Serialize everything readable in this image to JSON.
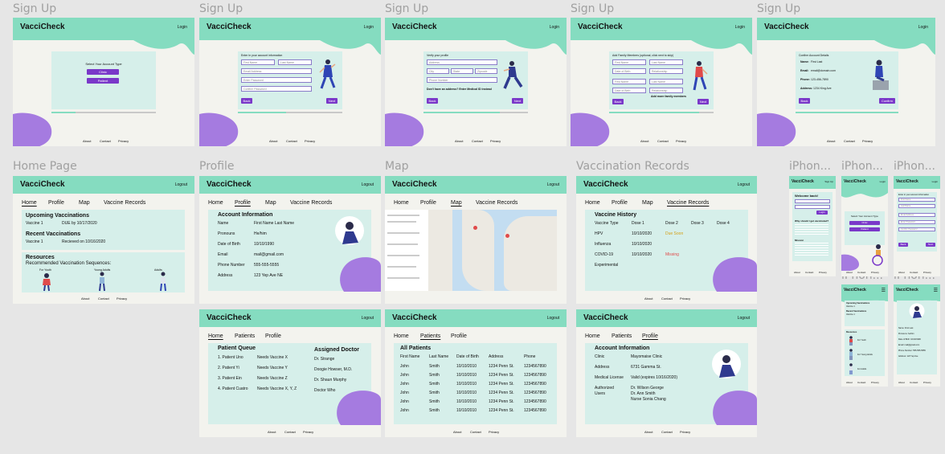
{
  "brand": "VacciCheck",
  "colors": {
    "header": "#85dcc0",
    "panel": "#d6efea",
    "accent": "#7a38c9",
    "blob": "#a57be0",
    "bg": "#f3f3ee",
    "canvas": "#e6e6e6",
    "warn": "#d4a017",
    "danger": "#e04a4a"
  },
  "footer": {
    "about": "About",
    "contact": "Contact",
    "privacy": "Privacy"
  },
  "nav": {
    "home": "Home",
    "profile": "Profile",
    "map": "Map",
    "records": "Vaccine Records",
    "patients": "Patients"
  },
  "header_links": {
    "login": "Login",
    "logout": "Logout",
    "signup": "Sign Up"
  },
  "labels": {
    "signup": "Sign Up",
    "home": "Home Page",
    "profile": "Profile",
    "map": "Map",
    "vrec": "Vaccination Records",
    "vrec2": "Vaccination Records",
    "vrec3": "Vaccination Records",
    "profile2": "Profile",
    "iphone1": "iPhon...",
    "iphone2": "iPhon...",
    "iphone3": "iPhon...",
    "iphone4": "iPhon...",
    "iphone5": "iPhon..."
  },
  "signup1": {
    "prompt": "Select Your Account Type",
    "clinic": "Clinic",
    "patient": "Patient"
  },
  "signup2": {
    "prompt": "Enter in your account information",
    "first": "First Name",
    "last": "Last Name",
    "email": "Email Address",
    "password": "Enter Password",
    "confirm": "Confirm Password",
    "back": "Back",
    "next": "Next"
  },
  "signup3": {
    "prompt": "Verify your profile",
    "address": "Address",
    "city": "City",
    "state": "State",
    "zip": "Zipcode",
    "phone": "Phone Number",
    "note": "Don't have an address? Enter Medical ID instead",
    "back": "Back",
    "next": "Next"
  },
  "signup4": {
    "prompt": "Add Family Members (optional, click next to skip)",
    "first": "First Name",
    "last": "Last Name",
    "dob": "Date of Birth",
    "relationship": "Relationship",
    "add": "Add more family members",
    "back": "Back",
    "next": "Next"
  },
  "signup5": {
    "prompt": "Confirm Account Details",
    "name_k": "Name:",
    "name_v": "First Last",
    "email_k": "Email:",
    "email_v": "email@domain.com",
    "phone_k": "Phone:",
    "phone_v": "123-456-7890",
    "addr_k": "Address:",
    "addr_v": "1234 King Ave",
    "back": "Back",
    "confirm": "Confirm"
  },
  "homepage": {
    "upcoming": "Upcoming Vaccinations",
    "up_row": "Vaccine 1",
    "up_due": "DUE by 10/17/2020",
    "recent": "Recent Vaccinations",
    "re_row": "Vaccine 1",
    "re_date": "Recieved on 10/16/2020",
    "resources": "Resources",
    "rec": "Recommended Vaccination Sequences:",
    "kids": "For Youth",
    "young": "Young Adults",
    "adults": "Adults"
  },
  "profile": {
    "title": "Account Information",
    "rows": [
      {
        "k": "Name",
        "v": "First Name Last Name"
      },
      {
        "k": "Pronouns",
        "v": "He/him"
      },
      {
        "k": "Date of Birth",
        "v": "10/10/1990"
      },
      {
        "k": "Email",
        "v": "mail@gmail.com"
      },
      {
        "k": "Phone Number",
        "v": "555-555-5555"
      },
      {
        "k": "Address",
        "v": "123 Yep Ave NE"
      }
    ]
  },
  "records": {
    "title": "Vaccine History",
    "head": [
      "Vaccine Type",
      "Dose 1",
      "Dose 2",
      "Dose 3",
      "Dose 4"
    ],
    "rows": [
      {
        "name": "HPV",
        "d1": "10/10/2020",
        "d2": "Due Soon"
      },
      {
        "name": "Influenza",
        "d1": "10/10/2020",
        "d2": ""
      },
      {
        "name": "COVID-19",
        "d1": "10/10/2020",
        "d2": "Missing"
      },
      {
        "name": "Experimental",
        "d1": "",
        "d2": ""
      }
    ]
  },
  "queue": {
    "title": "Patient Queue",
    "doctor_title": "Assigned Doctor",
    "rows": [
      {
        "p": "1. Patient Uno",
        "n": "Needs Vaccine X",
        "d": "Dr. Strange"
      },
      {
        "p": "2. Patient Yi",
        "n": "Needs Vaccine Y",
        "d": "Doogie Howser, M.D."
      },
      {
        "p": "3. Patient Ein",
        "n": "Needs Vaccine Z",
        "d": "Dr. Shaun Murphy"
      },
      {
        "p": "4. Patient Cuatro",
        "n": "Needs Vaccine X, Y, Z",
        "d": "Doctor Who"
      }
    ]
  },
  "patients": {
    "title": "All Patients",
    "head": [
      "First Name",
      "Last Name",
      "Date of Birth",
      "Address",
      "Phone"
    ],
    "row": [
      "John",
      "Smith",
      "10/10/2010",
      "1234 Penn St.",
      "1234567890"
    ]
  },
  "clinic": {
    "title": "Account Information",
    "rows": [
      {
        "k": "Clinic",
        "v": "Mayomaise Clinic"
      },
      {
        "k": "Address",
        "v": "6731 Gamma St."
      },
      {
        "k": "Medical License",
        "v": "Valid (expires 10/16/2020)"
      },
      {
        "k": "Authorized",
        "v": "Dr. Wilson George"
      },
      {
        "k": "Users",
        "v": "Dr. Ann Smith"
      },
      {
        "k": "",
        "v": "Nurse Sonia Chang"
      }
    ]
  },
  "mobile": {
    "welcome": "Welcome back!",
    "login": "Login",
    "signup": "Sign Up",
    "why": "Why should I get vaccinated?",
    "mission": "Mission",
    "select": "Select Your Account Type",
    "clinic": "Clinic",
    "patient": "Patient",
    "back": "Back",
    "next": "Next",
    "upcoming": "Upcoming Vaccinations",
    "recent": "Recent Vaccinations",
    "resources": "Resources",
    "kids": "For Youth",
    "young": "For Young Adults",
    "adults": "For Adults",
    "name": "Name: First Last",
    "pronouns": "Pronouns: he/him",
    "dob": "Date of Birth: 10/10/1990",
    "email": "Email: mail@gmail.com",
    "phone": "Phone Number: 555-555-5555",
    "address": "Address: 123 Yep Ave"
  }
}
